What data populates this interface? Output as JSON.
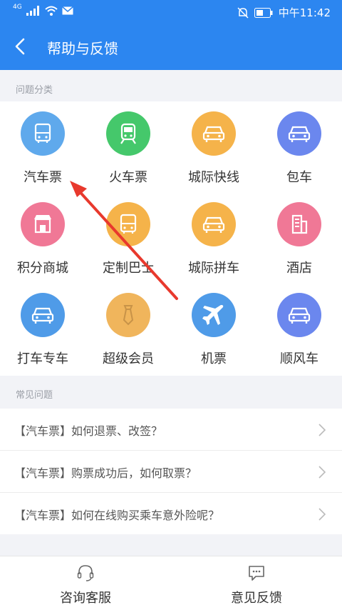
{
  "status": {
    "network": "4G",
    "time": "中午11:42"
  },
  "header": {
    "title": "帮助与反馈"
  },
  "categories_section": {
    "label": "问题分类",
    "items": [
      {
        "label": "汽车票",
        "icon": "bus-icon",
        "color": "#5fa9ec"
      },
      {
        "label": "火车票",
        "icon": "train-icon",
        "color": "#45c86b"
      },
      {
        "label": "城际快线",
        "icon": "car-icon",
        "color": "#f5b34a"
      },
      {
        "label": "包车",
        "icon": "car-icon",
        "color": "#6b87ee"
      },
      {
        "label": "积分商城",
        "icon": "shop-icon",
        "color": "#f07896"
      },
      {
        "label": "定制巴士",
        "icon": "bus-icon",
        "color": "#f5b34a"
      },
      {
        "label": "城际拼车",
        "icon": "car-icon",
        "color": "#f5b34a"
      },
      {
        "label": "酒店",
        "icon": "hotel-icon",
        "color": "#f07896"
      },
      {
        "label": "打车专车",
        "icon": "car-icon",
        "color": "#4f9be8"
      },
      {
        "label": "超级会员",
        "icon": "tie-icon",
        "color": "#f0b55c"
      },
      {
        "label": "机票",
        "icon": "plane-icon",
        "color": "#4f9be8"
      },
      {
        "label": "顺风车",
        "icon": "car-icon",
        "color": "#6b87ee"
      }
    ]
  },
  "faq_section": {
    "label": "常见问题",
    "items": [
      {
        "text": "【汽车票】如何退票、改签？"
      },
      {
        "text": "【汽车票】购票成功后，如何取票？"
      },
      {
        "text": "【汽车票】如何在线购买乘车意外险呢？"
      }
    ]
  },
  "bottom": {
    "service": "咨询客服",
    "feedback": "意见反馈"
  },
  "colors": {
    "primary": "#2c86f0",
    "annotation_arrow": "#e8392d"
  }
}
